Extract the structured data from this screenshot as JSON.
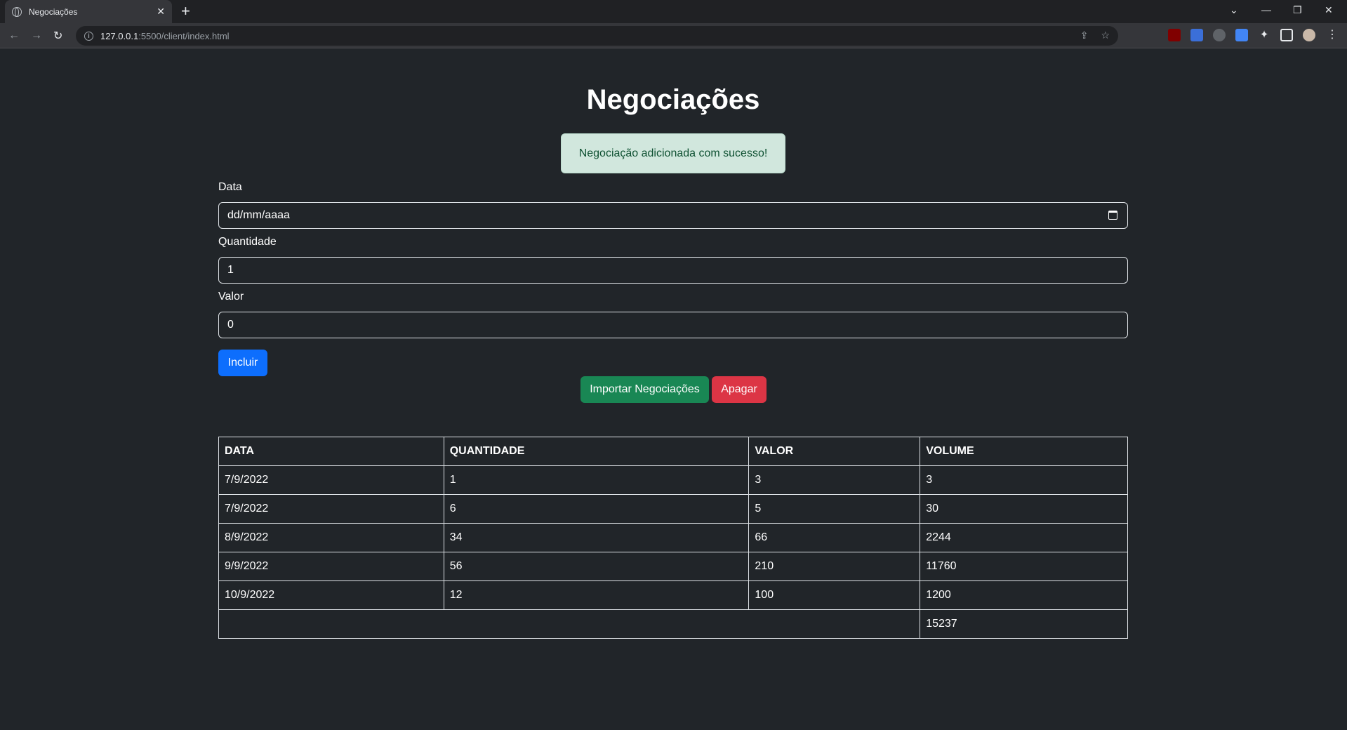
{
  "browser": {
    "tab_title": "Negociações",
    "tab_close": "✕",
    "new_tab": "+",
    "url_host": "127.0.0.1",
    "url_path": ":5500/client/index.html"
  },
  "page": {
    "title": "Negociações",
    "alert": "Negociação adicionada com sucesso!",
    "form": {
      "data_label": "Data",
      "data_placeholder": "dd/mm/aaaa",
      "quantidade_label": "Quantidade",
      "quantidade_value": "1",
      "valor_label": "Valor",
      "valor_value": "0",
      "incluir_label": "Incluir"
    },
    "buttons": {
      "importar": "Importar Negociações",
      "apagar": "Apagar"
    },
    "table": {
      "headers": [
        "DATA",
        "QUANTIDADE",
        "VALOR",
        "VOLUME"
      ],
      "rows": [
        [
          "7/9/2022",
          "1",
          "3",
          "3"
        ],
        [
          "7/9/2022",
          "6",
          "5",
          "30"
        ],
        [
          "8/9/2022",
          "34",
          "66",
          "2244"
        ],
        [
          "9/9/2022",
          "56",
          "210",
          "11760"
        ],
        [
          "10/9/2022",
          "12",
          "100",
          "1200"
        ]
      ],
      "total": "15237"
    }
  },
  "colors": {
    "background": "#212529",
    "primary": "#0d6efd",
    "success": "#198754",
    "danger": "#dc3545",
    "alert_bg": "#d1e7dd"
  }
}
